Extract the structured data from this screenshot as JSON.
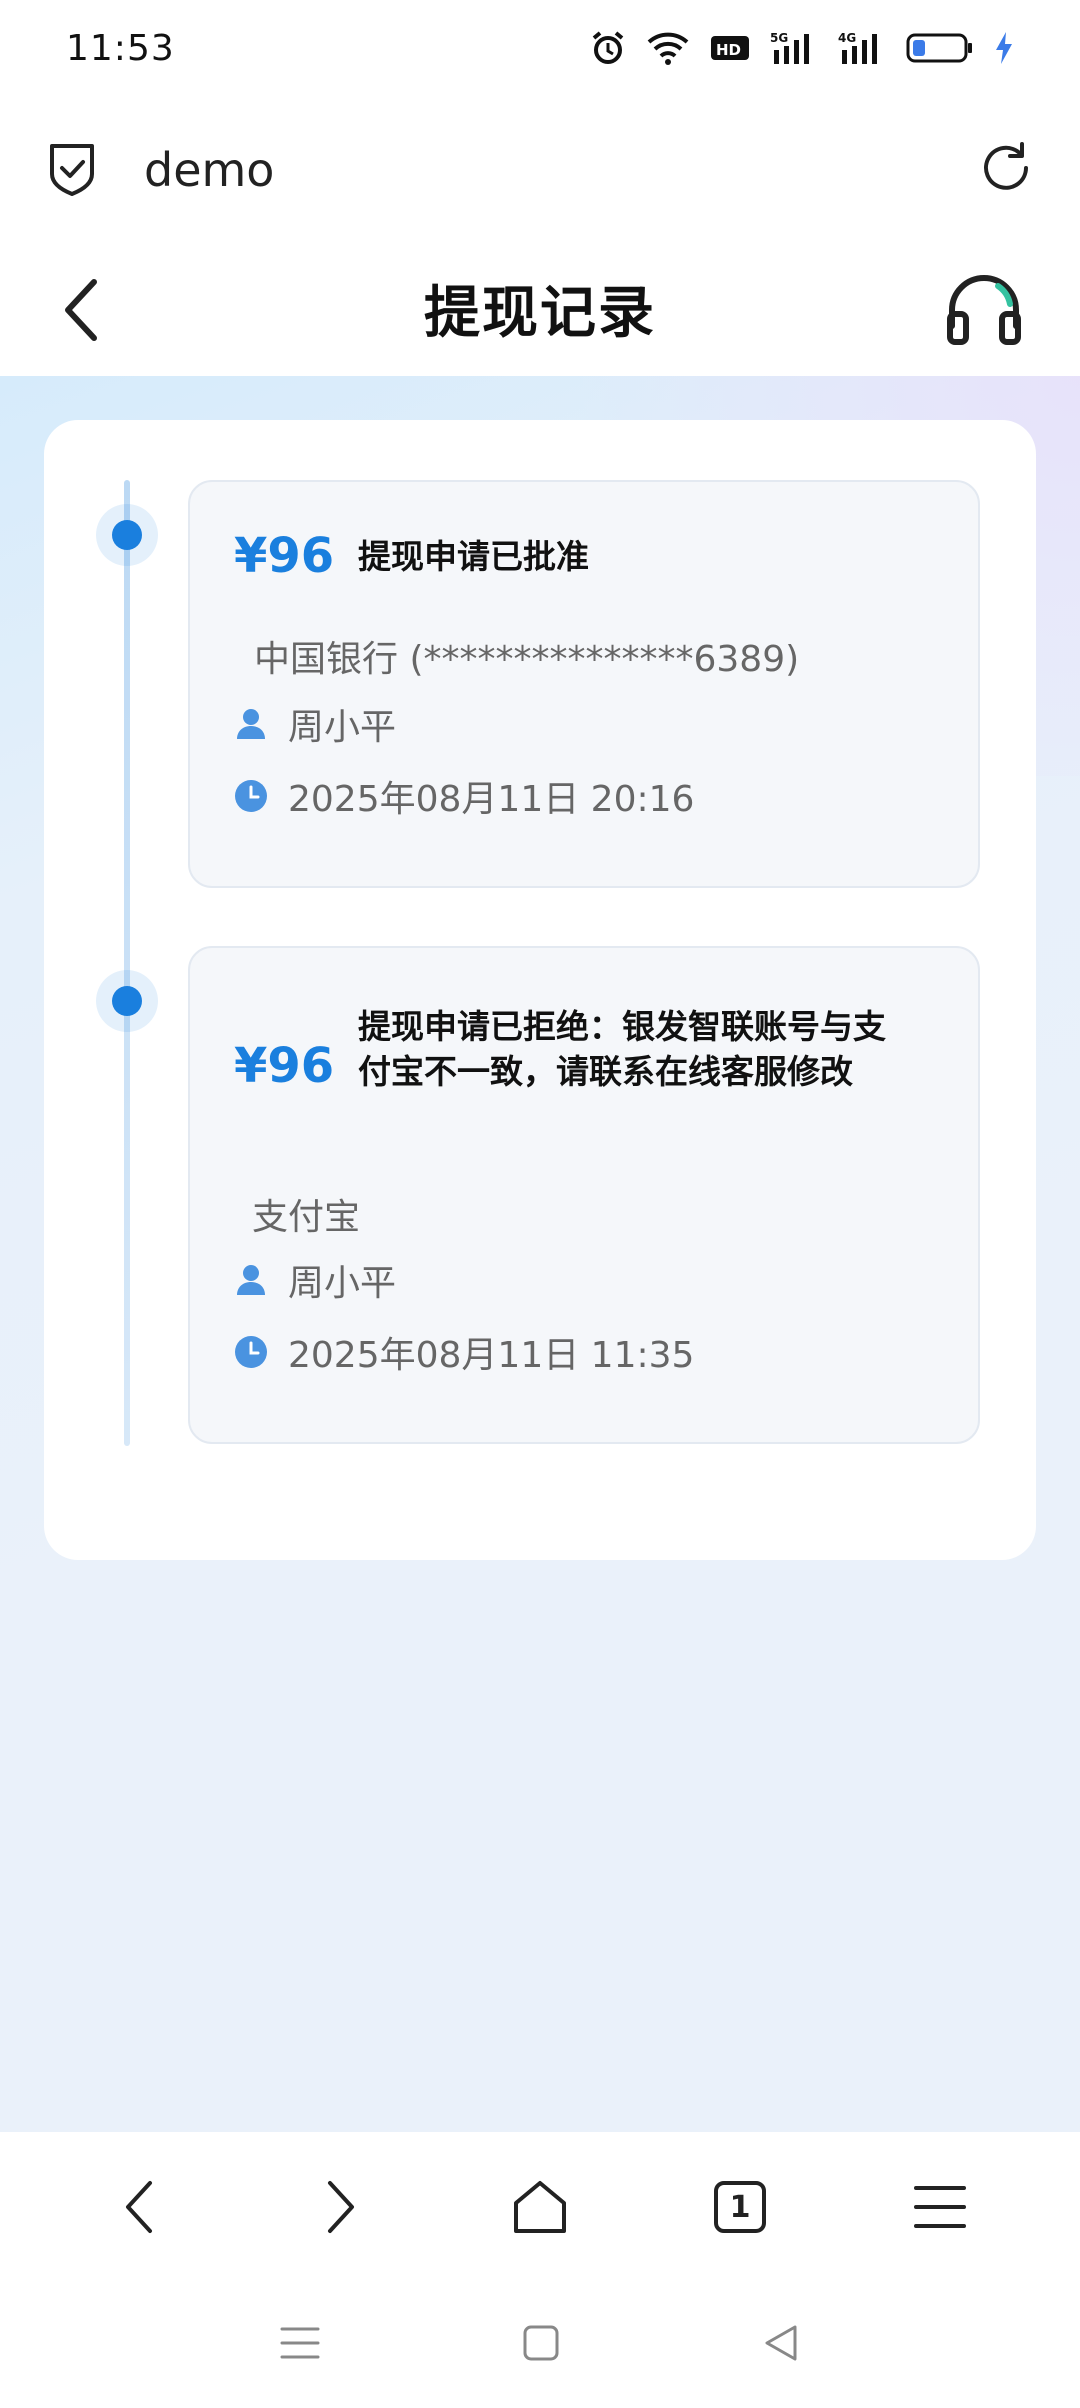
{
  "status_bar": {
    "time": "11:53",
    "icons": [
      "alarm-icon",
      "wifi-icon",
      "hd-icon",
      "signal-5g-icon",
      "signal-4g-icon",
      "battery-icon",
      "charging-icon"
    ]
  },
  "browser": {
    "title": "demo"
  },
  "header": {
    "title": "提现记录"
  },
  "records": [
    {
      "amount": "¥96",
      "status": "提现申请已批准",
      "account": "中国银行 (***************6389)",
      "name": "周小平",
      "time": "2025年08月11日 20:16"
    },
    {
      "amount": "¥96",
      "status": "提现申请已拒绝：银发智联账号与支付宝不一致，请联系在线客服修改",
      "account": "支付宝",
      "name": "周小平",
      "time": "2025年08月11日 11:35"
    }
  ],
  "bottom_nav": {
    "tab_count": "1"
  },
  "colors": {
    "accent": "#1a7fde",
    "text_secondary": "#666666"
  }
}
